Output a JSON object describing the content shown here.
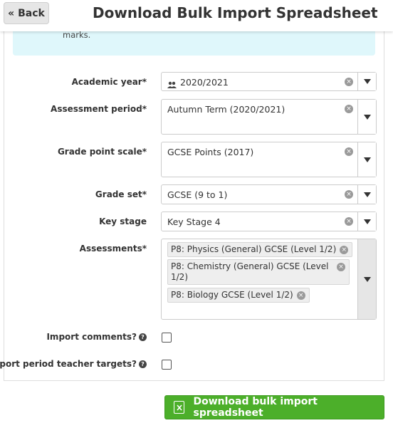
{
  "header": {
    "back_label": "« Back",
    "title": "Download Bulk Import Spreadsheet"
  },
  "info": {
    "text": "marks."
  },
  "form": {
    "academic_year": {
      "label": "Academic year*",
      "value": "2020/2021",
      "icon": "users-icon"
    },
    "assessment_period": {
      "label": "Assessment period*",
      "value": "Autumn Term (2020/2021)"
    },
    "grade_point_scale": {
      "label": "Grade point scale*",
      "value": "GCSE Points (2017)"
    },
    "grade_set": {
      "label": "Grade set*",
      "value": "GCSE (9 to 1)"
    },
    "key_stage": {
      "label": "Key stage",
      "value": "Key Stage 4"
    },
    "assessments": {
      "label": "Assessments*",
      "tags": [
        "P8: Physics (General) GCSE (Level 1/2)",
        "P8: Chemistry (General) GCSE (Level 1/2)",
        "P8: Biology GCSE (Level 1/2)"
      ]
    },
    "import_comments": {
      "label": "Import comments?",
      "checked": false
    },
    "import_targets": {
      "label": "Import period teacher targets?",
      "checked": false
    }
  },
  "actions": {
    "download_label": "Download bulk import spreadsheet"
  },
  "colors": {
    "info_bg": "#dff7fb",
    "download_bg": "#4caf2a"
  }
}
